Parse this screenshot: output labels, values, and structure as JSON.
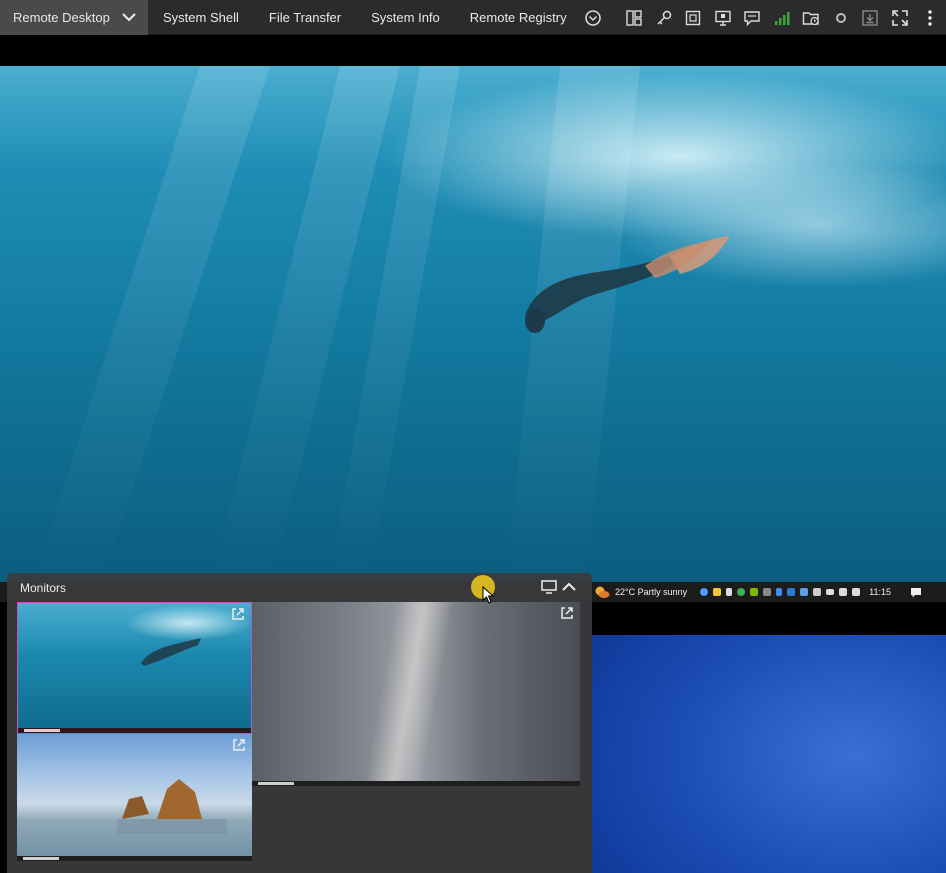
{
  "toolbar": {
    "active_tab": "Remote Desktop",
    "tabs": [
      "System Shell",
      "File Transfer",
      "System Info",
      "Remote Registry"
    ],
    "icons": [
      "chevron-circle-icon",
      "layout-icon",
      "key-icon",
      "frame-icon",
      "monitor-icon",
      "chat-icon",
      "signal-icon",
      "folder-clock-icon",
      "record-icon",
      "download-icon",
      "fullscreen-icon"
    ]
  },
  "remote_taskbar": {
    "weather": "22°C  Partly sunny",
    "time": "11:15"
  },
  "monitors_panel": {
    "title": "Monitors"
  },
  "colors": {
    "toolbar_bg": "#2b2b2b",
    "active_tab_bg": "#4a4a4a",
    "selected_monitor_border": "#b05acb",
    "signal_green": "#3aa63a"
  }
}
